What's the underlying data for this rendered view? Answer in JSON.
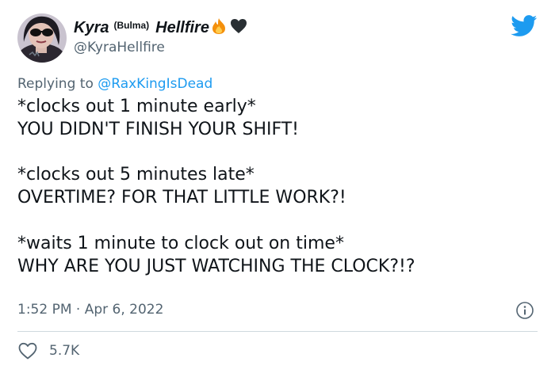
{
  "author": {
    "name_first": "Kyra",
    "name_middle": "(Bulma)",
    "name_last": "Hellfire",
    "name_emojis": [
      "fire-emoji",
      "black-heart-emoji"
    ],
    "handle": "@KyraHellfire"
  },
  "reply": {
    "prefix": "Replying to",
    "mention": "@RaxKingIsDead"
  },
  "tweet": {
    "paragraphs": [
      [
        "*clocks out 1 minute early*",
        "YOU DIDN'T FINISH YOUR SHIFT!"
      ],
      [
        "*clocks out 5 minutes late*",
        "OVERTIME? FOR THAT LITTLE WORK?!"
      ],
      [
        "*waits 1 minute to clock out on time*",
        "WHY ARE YOU JUST WATCHING THE CLOCK?!?"
      ]
    ]
  },
  "meta": {
    "time": "1:52 PM",
    "separator": "·",
    "date": "Apr 6, 2022"
  },
  "engagement": {
    "likes": "5.7K"
  },
  "icons": {
    "platform": "twitter-bird-icon",
    "info": "info-icon",
    "like": "heart-icon"
  },
  "colors": {
    "brand_blue": "#1d9bf0",
    "text_primary": "#0f1419",
    "text_secondary": "#536471",
    "divider": "#cfd9de",
    "fire": "#f4900c",
    "black_heart": "#292f33"
  }
}
